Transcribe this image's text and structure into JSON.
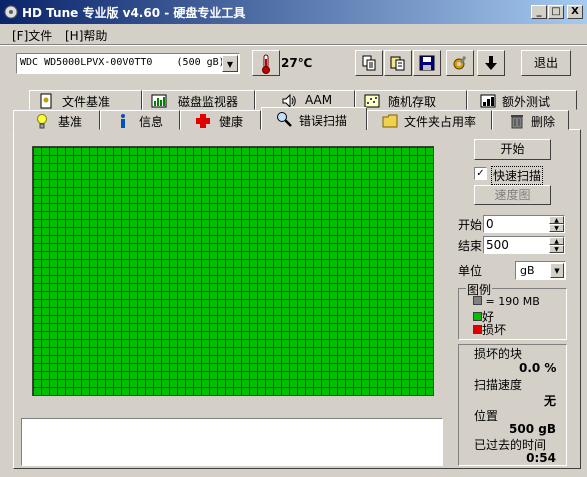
{
  "window": {
    "title": "HD Tune 专业版 v4.60 - 硬盘专业工具",
    "minimize": "_",
    "maximize": "□",
    "close": "X"
  },
  "menu": [
    {
      "label": "[F]文件"
    },
    {
      "label": "[H]帮助"
    }
  ],
  "toolbar": {
    "drive": "WDC WD5000LPVX-00V0TT0    (500 gB)",
    "temperature": "27℃",
    "exit_label": "退出",
    "icons": [
      "copy-text-icon",
      "copy-screenshot-icon",
      "save-icon",
      "options-icon",
      "down-arrow-icon"
    ]
  },
  "tabs_row1": [
    {
      "label": "文件基准",
      "icon": "file-benchmark-icon"
    },
    {
      "label": "磁盘监视器",
      "icon": "disk-monitor-icon"
    },
    {
      "label": "AAM",
      "icon": "speaker-icon"
    },
    {
      "label": "随机存取",
      "icon": "random-access-icon"
    },
    {
      "label": "额外测试",
      "icon": "extra-tests-icon"
    }
  ],
  "tabs_row2": [
    {
      "label": "基准",
      "icon": "benchmark-icon"
    },
    {
      "label": "信息",
      "icon": "info-icon"
    },
    {
      "label": "健康",
      "icon": "health-icon"
    },
    {
      "label": "错误扫描",
      "icon": "magnifier-icon",
      "active": true
    },
    {
      "label": "文件夹占用率",
      "icon": "folder-icon"
    },
    {
      "label": "删除",
      "icon": "trash-icon"
    }
  ],
  "error_scan": {
    "start_button": "开始",
    "quick_scan_label": "快速扫描",
    "quick_scan_checked": true,
    "speed_map_button": "速度图",
    "start_label": "开始",
    "start_value": "0",
    "end_label": "结束",
    "end_value": "500",
    "unit_label": "单位",
    "unit_value": "gB",
    "legend": {
      "title": "图例",
      "block_size": "= 190 MB",
      "good": "好",
      "bad": "损坏",
      "colors": {
        "block": "#808080",
        "good": "#00c000",
        "bad": "#e00000"
      }
    },
    "stats": {
      "damaged_blocks_label": "损坏的块",
      "damaged_blocks_value": "0.0 %",
      "scan_speed_label": "扫描速度",
      "scan_speed_value": "无",
      "position_label": "位置",
      "position_value": "500 gB",
      "elapsed_label": "已过去的时间",
      "elapsed_value": "0:54"
    },
    "grid_color": "#00c000"
  }
}
